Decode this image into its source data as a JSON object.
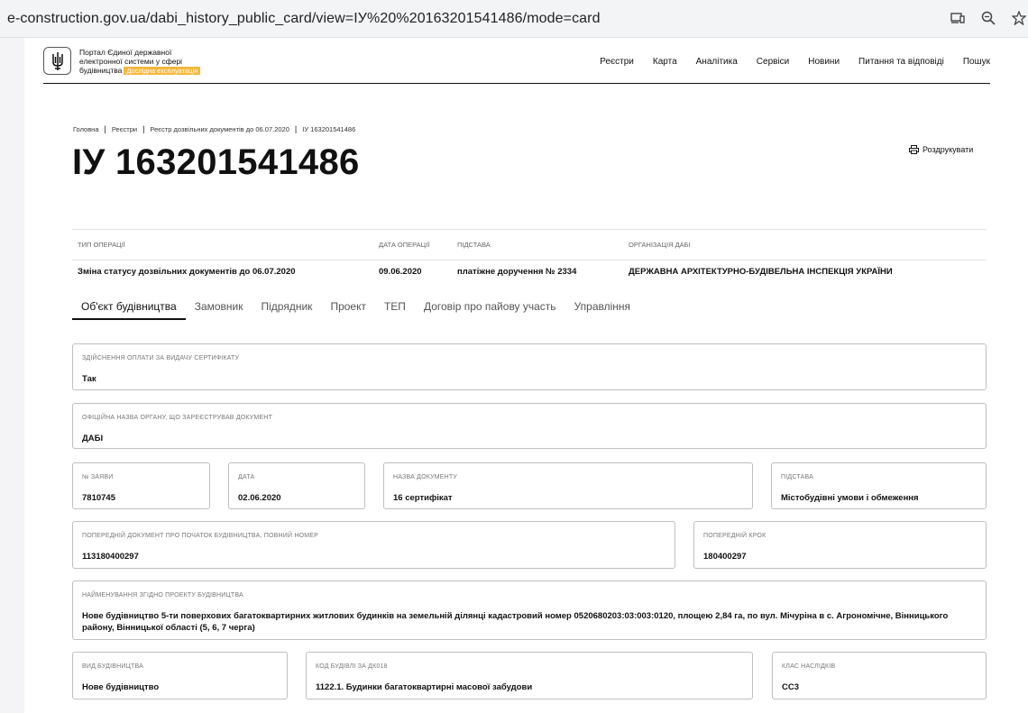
{
  "browser": {
    "url": "e-construction.gov.ua/dabi_history_public_card/view=ІУ%20%20163201541486/mode=card"
  },
  "header": {
    "portal_line1": "Портал Єдиної державної",
    "portal_line2": "електронної системи у сфері",
    "portal_line3": "будівництва",
    "beta": "Дослідна експлуатація",
    "nav": [
      "Реєстри",
      "Карта",
      "Аналітика",
      "Сервіси",
      "Новини",
      "Питання та відповіді",
      "Пошук"
    ]
  },
  "breadcrumb": [
    "Головна",
    "Реєстри",
    "Реєстр дозвільних документів до 06.07.2020",
    "ІУ 163201541486"
  ],
  "title": "ІУ 163201541486",
  "print_label": "Роздрукувати",
  "operation": {
    "headers": [
      "Тип операції",
      "Дата операції",
      "Підстава",
      "Організація ДАБІ"
    ],
    "values": [
      "Зміна статусу дозвільних документів до 06.07.2020",
      "09.06.2020",
      "платіжне доручення № 2334",
      "ДЕРЖАВНА АРХІТЕКТУРНО-БУДІВЕЛЬНА ІНСПЕКЦІЯ УКРАЇНИ"
    ]
  },
  "tabs": [
    "Об'єкт будівництва",
    "Замовник",
    "Підрядник",
    "Проект",
    "ТЕП",
    "Договір про пайову участь",
    "Управління"
  ],
  "fields": {
    "payment": {
      "label": "Здійснення оплати за видачу сертифікату",
      "value": "Так"
    },
    "organ": {
      "label": "Офіційна назва органу, що зареєстрував документ",
      "value": "ДАБІ"
    },
    "app_no": {
      "label": "№ заяви",
      "value": "7810745"
    },
    "date": {
      "label": "Дата",
      "value": "02.06.2020"
    },
    "doc_name": {
      "label": "Назва документу",
      "value": "16 сертифікат"
    },
    "basis": {
      "label": "Підстава",
      "value": "Містобудівні умови і обмеження"
    },
    "prev_doc": {
      "label": "Попередній документ про початок будівництва, повний номер",
      "value": "113180400297"
    },
    "prev_step": {
      "label": "Попередній крок",
      "value": "180400297"
    },
    "project_name": {
      "label": "Найменування згідно проекту будівництва",
      "value": "Нове будівництво 5-ти поверхових багатоквартирних житлових будинків на земельній ділянці кадастровий номер 0520680203:03:003:0120, площею 2,84 га, по вул. Мічуріна в с. Агрономічне, Вінницького району, Вінницької області (5, 6, 7 черга)"
    },
    "construction_type": {
      "label": "Вид будівництва",
      "value": "Нове будівництво"
    },
    "building_code": {
      "label": "Код будівлі за ДК018",
      "value": "1122.1. Будинки багатоквартирні масової забудови"
    },
    "consequence_class": {
      "label": "Клас наслідків",
      "value": "СС3"
    }
  }
}
